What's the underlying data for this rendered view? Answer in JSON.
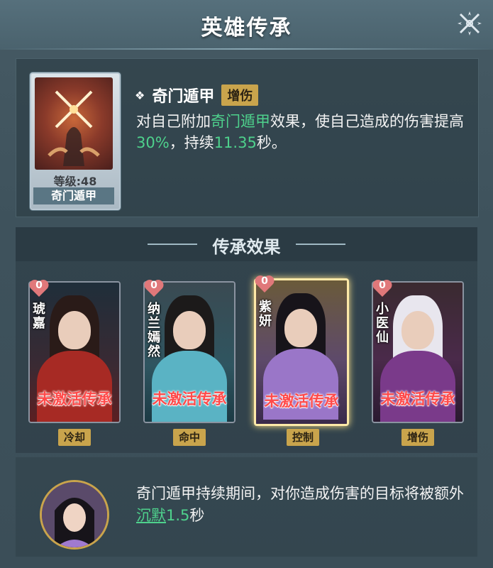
{
  "header": {
    "title": "英雄传承",
    "close_icon": "close-icon"
  },
  "skill": {
    "name": "奇门遁甲",
    "level_text": "等级:48",
    "tag": "增伤",
    "desc": {
      "p1": "对自己附加",
      "h1": "奇门遁甲",
      "p2": "效果，使自己造成的伤害提高",
      "h2": "30%",
      "p3": "，持续",
      "h3": "11.35",
      "p4": "秒。"
    }
  },
  "section": {
    "title": "传承效果"
  },
  "cards": [
    {
      "name": "琥嘉",
      "count": "0",
      "status": "未激活传承",
      "tag": "冷却",
      "selected": false
    },
    {
      "name": "纳兰嫣然",
      "count": "0",
      "status": "未激活传承",
      "tag": "命中",
      "selected": false
    },
    {
      "name": "紫妍",
      "count": "0",
      "status": "未激活传承",
      "tag": "控制",
      "selected": true
    },
    {
      "name": "小医仙",
      "count": "0",
      "status": "未激活传承",
      "tag": "增伤",
      "selected": false
    }
  ],
  "bottom": {
    "p1": "奇门遁甲持续期间，对你造成伤害的目标将被额外",
    "h1": "沉默",
    "h2": "1.5",
    "p2": "秒"
  },
  "colors": {
    "accent_green": "#4ed18c",
    "tag_gold": "#c9a44c",
    "inactive_red": "#ff4a4a",
    "selected_glow": "#ffe9a8"
  }
}
